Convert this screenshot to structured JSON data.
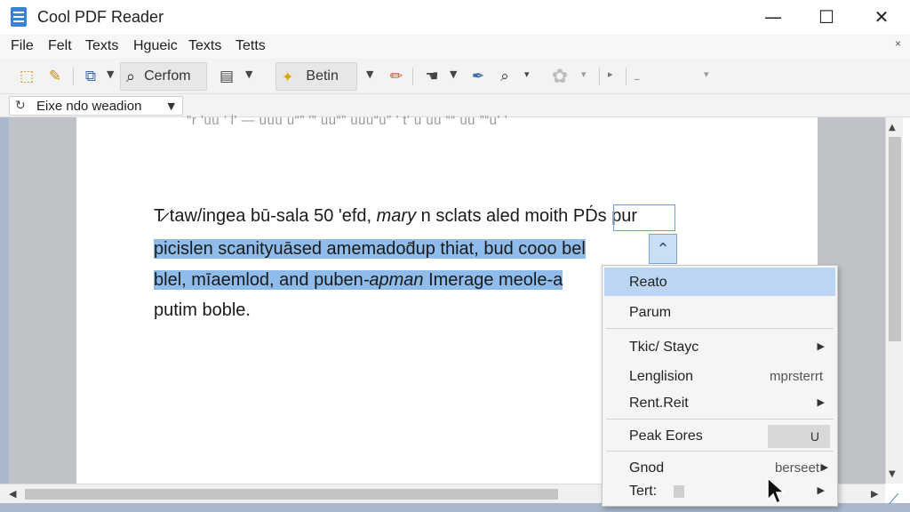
{
  "window": {
    "title": "Cool PDF Reader",
    "minimize": "—",
    "maximize": "☐",
    "close": "✕"
  },
  "menu": {
    "items": [
      "File",
      "Felt",
      "Texts",
      "Hgueic",
      "Texts",
      "Tetts"
    ],
    "close": "×"
  },
  "toolbar": {
    "search_label": "Cerfom",
    "edit_label": "Betin"
  },
  "zoom": {
    "value": "Eixe ndo weadion"
  },
  "document": {
    "faded_top": "\"r  'uu ’ l' —  uuu  u“” '”  uu“” uuu“u”  ’ t’  u uu  ““ uu ”“u' ’",
    "line1": "T̷ taw/ingea bū-sala 50 'efd,",
    "line1_italic": "mary",
    "line1_rest": "n sclats aled moith PD́s pur",
    "line2": "picislen scanityuāsed amemadod̄up thiat, bud cooo bel",
    "line3": "blel, mīaemlod, and puben",
    "line3_italic": "-apman",
    "line3_rest": "Imerage meole-a",
    "line4": "putim boble."
  },
  "context_menu": {
    "items": [
      {
        "label": "Reato",
        "shortcut": "",
        "submenu": false,
        "active": true
      },
      {
        "label": "Parum",
        "shortcut": "",
        "submenu": false,
        "active": false
      },
      {
        "label": "Tkic/ Stayc",
        "shortcut": "",
        "submenu": true,
        "active": false
      },
      {
        "label": "Lenglision",
        "shortcut": "mprsterrt",
        "submenu": false,
        "active": false
      },
      {
        "label": "Rent.Reit",
        "shortcut": "",
        "submenu": true,
        "active": false
      },
      {
        "label": "Peak Eores",
        "shortcut": "U",
        "submenu": false,
        "active": false
      },
      {
        "label": "Gnod",
        "shortcut": "berseet",
        "submenu": true,
        "active": false
      },
      {
        "label": "Tert:",
        "shortcut": "",
        "submenu": true,
        "active": false
      }
    ]
  },
  "colors": {
    "selection": "#8fbcea",
    "menu_highlight": "#bcd5f2",
    "app_icon": "#3b82d6"
  }
}
